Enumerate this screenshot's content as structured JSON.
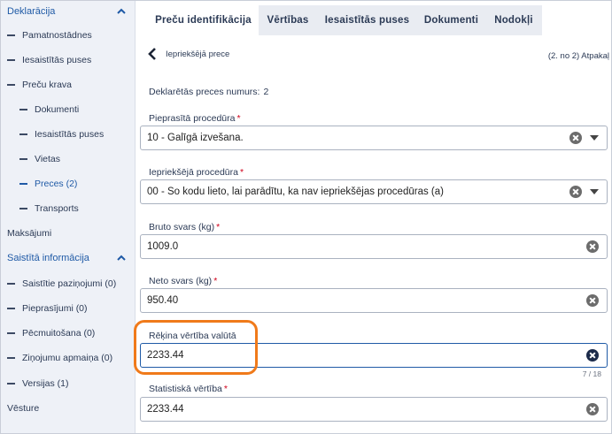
{
  "sidebar": {
    "section_declaration": "Deklarācija",
    "items": [
      {
        "label": "Pamatnostādnes"
      },
      {
        "label": "Iesaistītās puses"
      },
      {
        "label": "Preču krava"
      }
    ],
    "sub_items": [
      {
        "label": "Dokumenti"
      },
      {
        "label": "Iesaistītās puses"
      },
      {
        "label": "Vietas"
      },
      {
        "label": "Preces (2)"
      },
      {
        "label": "Transports"
      }
    ],
    "payments": "Maksājumi",
    "section_related": "Saistītā informācija",
    "related_items": [
      {
        "label": "Saistītie paziņojumi (0)"
      },
      {
        "label": "Pieprasījumi (0)"
      },
      {
        "label": "Pēcmuitošana (0)"
      },
      {
        "label": "Ziņojumu apmaiņa (0)"
      },
      {
        "label": "Versijas (1)"
      }
    ],
    "history": "Vēsture"
  },
  "tabs": [
    {
      "label": "Preču identifikācija"
    },
    {
      "label": "Vērtības"
    },
    {
      "label": "Iesaistītās puses"
    },
    {
      "label": "Dokumenti"
    },
    {
      "label": "Nodokļi"
    }
  ],
  "nav": {
    "back_label": "Iepriekšējā prece",
    "pager": "(2. no 2) Atpakaļ"
  },
  "declared": {
    "label": "Deklarētās preces numurs:",
    "value": "2"
  },
  "fields": {
    "requested_procedure": {
      "label": "Pieprasītā procedūra",
      "value": "10 - Galīgā izvešana."
    },
    "previous_procedure": {
      "label": "Iepriekšējā procedūra",
      "value": "00 - Šo kodu lieto, lai parādītu, ka nav iepriekšējas procedūras (a)"
    },
    "gross_weight": {
      "label": "Bruto svars (kg)",
      "value": "1009.0"
    },
    "net_weight": {
      "label": "Neto svars (kg)",
      "value": "950.40"
    },
    "invoice_value": {
      "label": "Rēķina vērtība valūtā",
      "value": "2233.44",
      "counter": "7 / 18"
    },
    "statistical_value": {
      "label": "Statistiskā vērtība",
      "value": "2233.44"
    }
  },
  "required_mark": "*",
  "colors": {
    "accent": "#1f5aa6",
    "highlight": "#f07a1a",
    "required": "#d0021b"
  }
}
